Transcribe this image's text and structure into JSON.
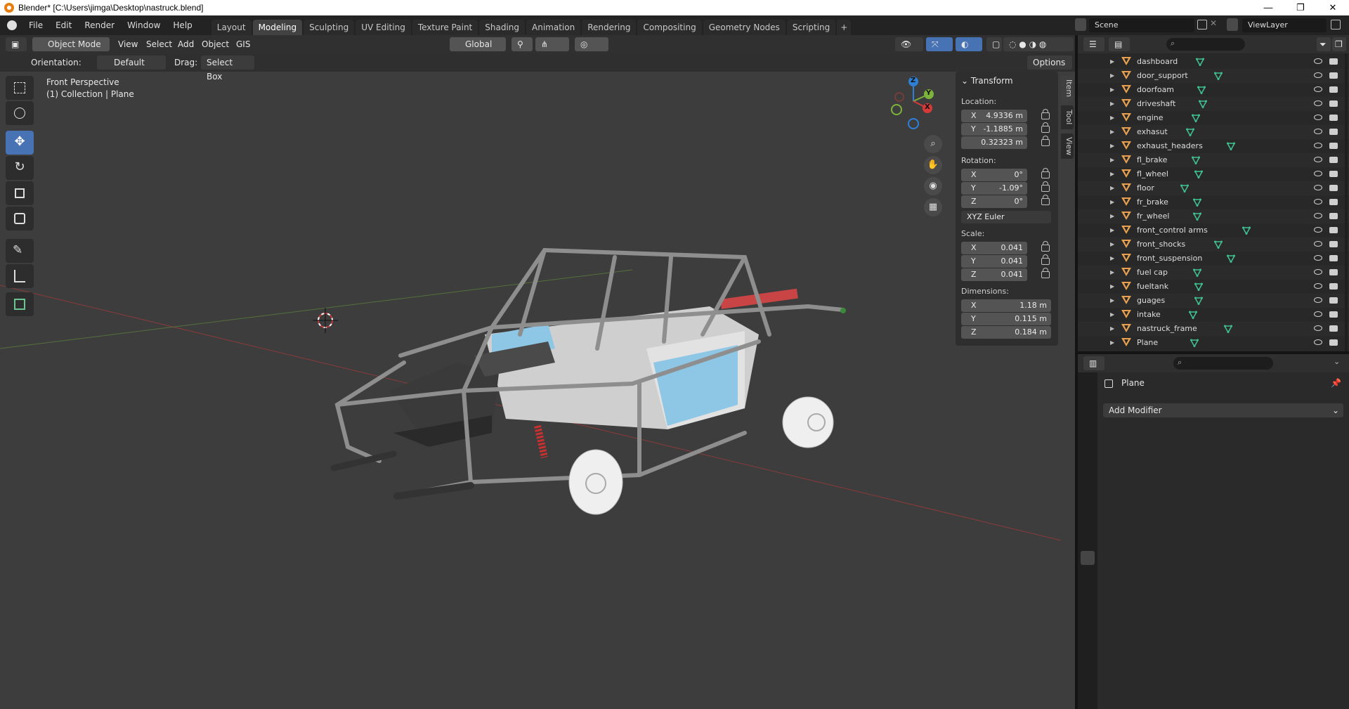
{
  "titlebar": {
    "title": "Blender* [C:\\Users\\jimga\\Desktop\\nastruck.blend]",
    "minimize": "—",
    "maximize": "❐",
    "close": "✕"
  },
  "menu": [
    "File",
    "Edit",
    "Render",
    "Window",
    "Help"
  ],
  "workspaces": [
    "Layout",
    "Modeling",
    "Sculpting",
    "UV Editing",
    "Texture Paint",
    "Shading",
    "Animation",
    "Rendering",
    "Compositing",
    "Geometry Nodes",
    "Scripting"
  ],
  "active_workspace": "Modeling",
  "scene": {
    "name": "Scene",
    "view_layer": "ViewLayer"
  },
  "header": {
    "mode": "Object Mode",
    "menus": [
      "View",
      "Select",
      "Add",
      "Object",
      "GIS"
    ],
    "transform_orientation": "Global",
    "options": "Options"
  },
  "toolsettings": {
    "orientation_label": "Orientation:",
    "orientation_value": "Default",
    "drag_label": "Drag:",
    "drag_value": "Select Box"
  },
  "viewport": {
    "view_name": "Front Perspective",
    "collection": "(1) Collection | Plane"
  },
  "gizmo": {
    "z": "Z",
    "y": "Y",
    "x": "X"
  },
  "npanel": {
    "title": "Transform",
    "location_label": "Location:",
    "location": [
      {
        "axis": "X",
        "value": "4.9336 m"
      },
      {
        "axis": "Y",
        "value": "-1.1885 m"
      },
      {
        "axis": "",
        "value": "0.32323 m"
      }
    ],
    "rotation_label": "Rotation:",
    "rotation": [
      {
        "axis": "X",
        "value": "0°"
      },
      {
        "axis": "Y",
        "value": "-1.09°"
      },
      {
        "axis": "Z",
        "value": "0°"
      }
    ],
    "rotation_mode": "XYZ Euler",
    "scale_label": "Scale:",
    "scale": [
      {
        "axis": "X",
        "value": "0.041"
      },
      {
        "axis": "Y",
        "value": "0.041"
      },
      {
        "axis": "Z",
        "value": "0.041"
      }
    ],
    "dimensions_label": "Dimensions:",
    "dimensions": [
      {
        "axis": "X",
        "value": "1.18 m"
      },
      {
        "axis": "Y",
        "value": "0.115 m"
      },
      {
        "axis": "Z",
        "value": "0.184 m"
      }
    ],
    "tabs": [
      "Item",
      "Tool",
      "View"
    ]
  },
  "outliner": {
    "items": [
      "dashboard",
      "door_support",
      "doorfoam",
      "driveshaft",
      "engine",
      "exhasut",
      "exhaust_headers",
      "fl_brake",
      "fl_wheel",
      "floor",
      "fr_brake",
      "fr_wheel",
      "front_control arms",
      "front_shocks",
      "front_suspension",
      "fuel cap",
      "fueltank",
      "guages",
      "intake",
      "nastruck_frame",
      "Plane"
    ]
  },
  "properties": {
    "object_name": "Plane",
    "add_modifier": "Add Modifier"
  },
  "colors": {
    "accent": "#4772b3",
    "viewport_bg": "#3d3d3d",
    "object_orange": "#e8a050",
    "mesh_green": "#3fbf8f"
  }
}
